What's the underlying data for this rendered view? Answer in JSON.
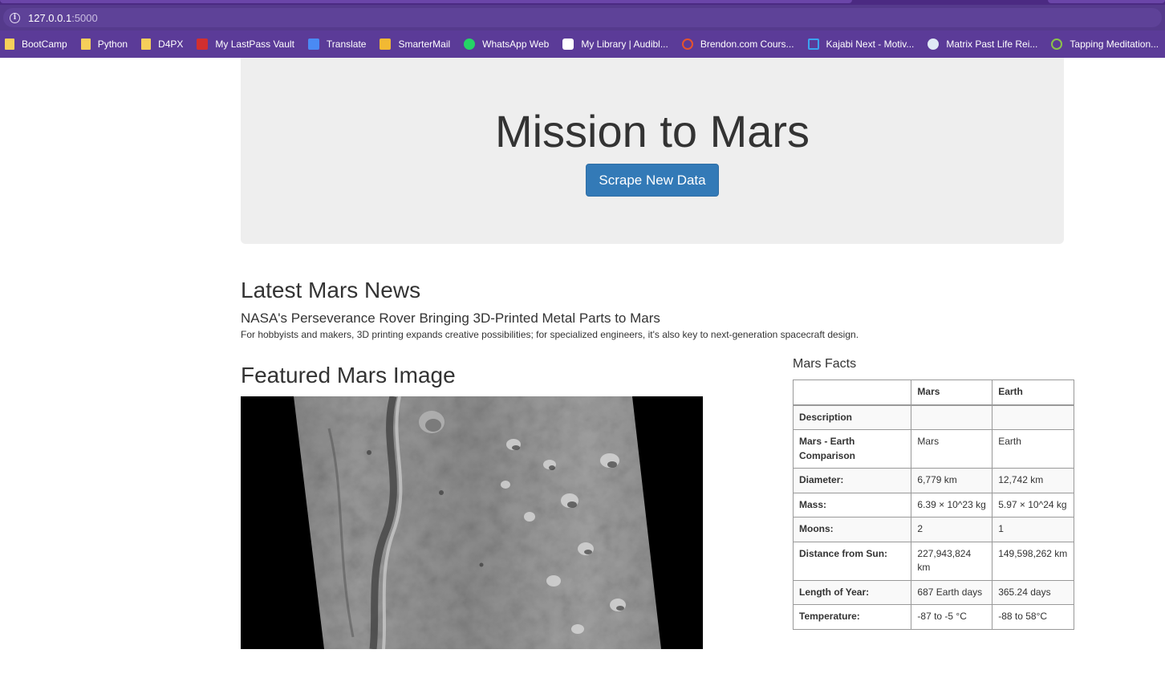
{
  "browser": {
    "url_host": "127.0.0.1",
    "url_port": ":5000",
    "bookmarks": [
      {
        "label": "BootCamp",
        "icon": "folder-icon"
      },
      {
        "label": "Python",
        "icon": "folder-icon"
      },
      {
        "label": "D4PX",
        "icon": "folder-icon"
      },
      {
        "label": "My LastPass Vault",
        "icon": "lastpass-icon"
      },
      {
        "label": "Translate",
        "icon": "google-translate-icon"
      },
      {
        "label": "SmarterMail",
        "icon": "mail-icon"
      },
      {
        "label": "WhatsApp Web",
        "icon": "whatsapp-icon"
      },
      {
        "label": "My Library | Audibl...",
        "icon": "amazon-icon"
      },
      {
        "label": "Brendon.com Cours...",
        "icon": "brendon-icon"
      },
      {
        "label": "Kajabi Next - Motiv...",
        "icon": "kajabi-icon"
      },
      {
        "label": "Matrix Past Life Rei...",
        "icon": "matrix-icon"
      },
      {
        "label": "Tapping Meditation...",
        "icon": "spiral-icon"
      }
    ]
  },
  "hero": {
    "title": "Mission to Mars",
    "button_label": "Scrape New Data",
    "button_color": "#337ab7"
  },
  "news": {
    "heading": "Latest Mars News",
    "title": "NASA's Perseverance Rover Bringing 3D-Printed Metal Parts to Mars",
    "teaser": "For hobbyists and makers, 3D printing expands creative possibilities; for specialized engineers, it's also key to next-generation spacecraft design."
  },
  "featured": {
    "heading": "Featured Mars Image"
  },
  "facts": {
    "heading": "Mars Facts",
    "columns": [
      "",
      "Mars",
      "Earth"
    ],
    "rows": [
      [
        "Description",
        "",
        ""
      ],
      [
        "Mars - Earth Comparison",
        "Mars",
        "Earth"
      ],
      [
        "Diameter:",
        "6,779 km",
        "12,742 km"
      ],
      [
        "Mass:",
        "6.39 × 10^23 kg",
        "5.97 × 10^24 kg"
      ],
      [
        "Moons:",
        "2",
        "1"
      ],
      [
        "Distance from Sun:",
        "227,943,824 km",
        "149,598,262 km"
      ],
      [
        "Length of Year:",
        "687 Earth days",
        "365.24 days"
      ],
      [
        "Temperature:",
        "-87 to -5 °C",
        "-88 to 58°C"
      ]
    ]
  }
}
